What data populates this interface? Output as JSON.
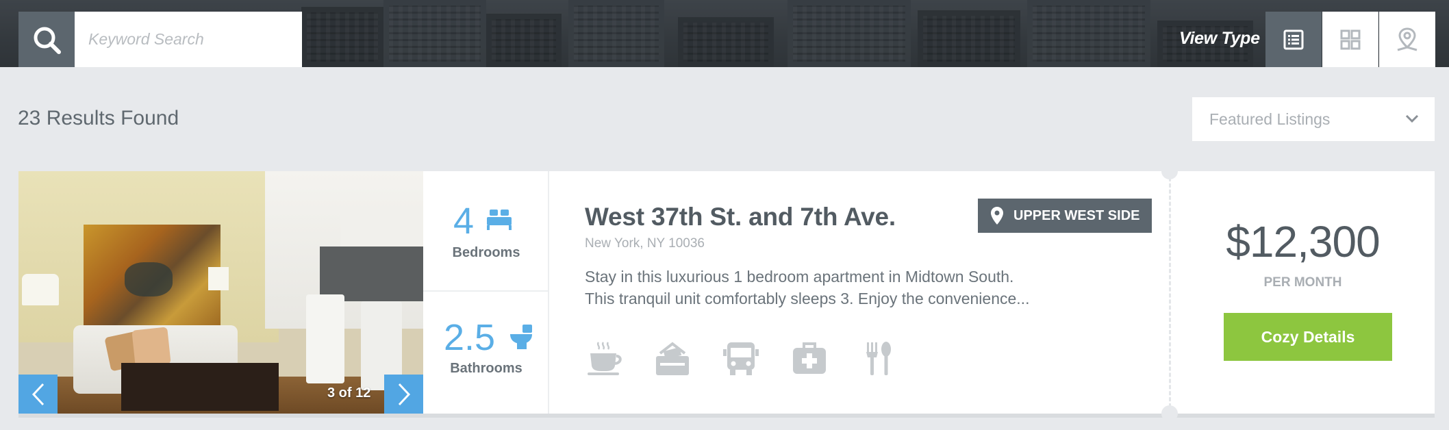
{
  "header": {
    "search": {
      "placeholder": "Keyword Search",
      "value": ""
    },
    "view_type_label": "View Type",
    "view_modes": [
      {
        "icon": "list-view-icon",
        "active": true
      },
      {
        "icon": "grid-view-icon",
        "active": false
      },
      {
        "icon": "map-pin-view-icon",
        "active": false
      }
    ]
  },
  "results": {
    "count_text": "23 Results Found",
    "sort_selected": "Featured Listings"
  },
  "listing": {
    "photo_counter": "3 of 12",
    "bedrooms": {
      "value": "4",
      "label": "Bedrooms",
      "icon": "bed-icon"
    },
    "bathrooms": {
      "value": "2.5",
      "label": "Bathrooms",
      "icon": "toilet-icon"
    },
    "title": "West 37th St. and 7th Ave.",
    "address": "New York, NY 10036",
    "neighborhood": "UPPER WEST SIDE",
    "description_line1": "Stay in this luxurious 1 bedroom apartment in Midtown South.",
    "description_line2": "This tranquil unit comfortably sleeps 3. Enjoy the convenience...",
    "amenities": [
      "coffee-icon",
      "mailbox-icon",
      "bus-icon",
      "medical-kit-icon",
      "fork-spoon-icon"
    ],
    "price": "$12,300",
    "price_period": "PER MONTH",
    "cta_label": "Cozy Details"
  },
  "colors": {
    "accent_blue": "#52a6e3",
    "cta_green": "#8dc63f",
    "slate": "#5c666e",
    "background": "#e7e9ec"
  }
}
